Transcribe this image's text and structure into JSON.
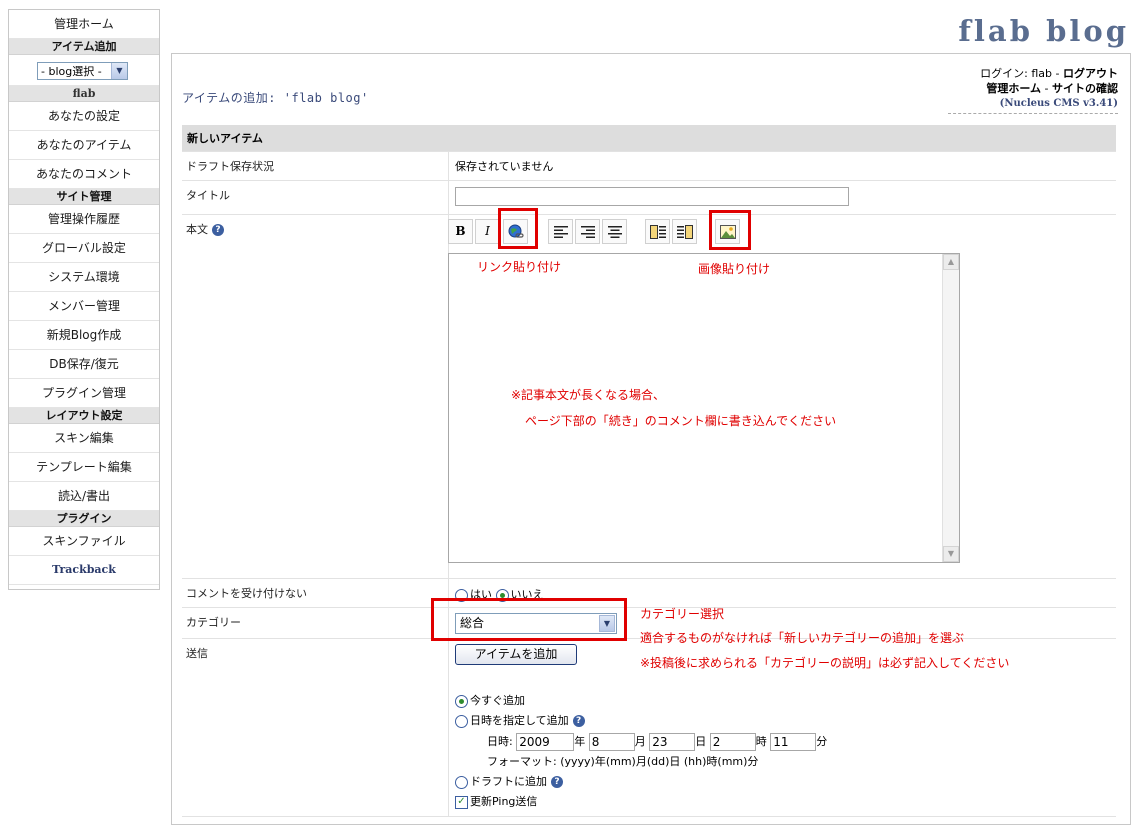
{
  "header": {
    "blog_title": "flab blog"
  },
  "sidebar": {
    "admin_home": "管理ホーム",
    "add_item_heading": "アイテム追加",
    "blog_select_value": "- blog選択 -",
    "user_heading": "flab",
    "your_settings": "あなたの設定",
    "your_items": "あなたのアイテム",
    "your_comments": "あなたのコメント",
    "site_admin_heading": "サイト管理",
    "action_log": "管理操作履歴",
    "global_settings": "グローバル設定",
    "system_env": "システム環境",
    "member_admin": "メンバー管理",
    "new_blog": "新規Blog作成",
    "db_backup": "DB保存/復元",
    "plugin_admin": "プラグイン管理",
    "layout_heading": "レイアウト設定",
    "skin_edit": "スキン編集",
    "template_edit": "テンプレート編集",
    "import_export": "読込/書出",
    "plugins_heading": "プラグイン",
    "skin_files": "スキンファイル",
    "trackback": "Trackback"
  },
  "login": {
    "prefix": "ログイン: flab - ",
    "logout": "ログアウト",
    "admin_home": "管理ホーム",
    "sep": " - ",
    "view_site": "サイトの確認",
    "cms_version": "(Nucleus CMS v3.41)"
  },
  "page": {
    "heading": "アイテムの追加: 'flab blog'"
  },
  "form": {
    "section_title": "新しいアイテム",
    "draft_status_label": "ドラフト保存状況",
    "draft_status_value": "保存されていません",
    "title_label": "タイトル",
    "title_value": "",
    "body_label": "本文",
    "toolbar": {
      "bold": "B",
      "italic": "I"
    },
    "no_comments_label": "コメントを受け付けない",
    "yes": "はい",
    "no": "いいえ",
    "category_label": "カテゴリー",
    "category_value": "総合",
    "submit_label": "送信",
    "submit_button": "アイテムを追加",
    "post_now": "今すぐ追加",
    "post_at_time": "日時を指定して追加",
    "datetime_label": "日時:",
    "year": "2009",
    "year_unit": "年",
    "month": "8",
    "month_unit": "月",
    "day": "23",
    "day_unit": "日",
    "hour": "2",
    "hour_unit": "時",
    "minute": "11",
    "minute_unit": "分",
    "format_hint": "フォーマット: (yyyy)年(mm)月(dd)日 (hh)時(mm)分",
    "add_to_draft": "ドラフトに追加",
    "send_ping": "更新Ping送信"
  },
  "annotations": {
    "link_paste": "リンク貼り付け",
    "image_paste": "画像貼り付け",
    "long_body_1": "※記事本文が長くなる場合、",
    "long_body_2": "ページ下部の「続き」のコメント欄に書き込んでください",
    "category_select": "カテゴリー選択",
    "category_hint": "適合するものがなければ「新しいカテゴリーの追加」を選ぶ",
    "category_note": "※投稿後に求められる「カテゴリーの説明」は必ず記入してください"
  },
  "colors": {
    "annotation_red": "#e00000",
    "heading_blue": "#5a6d8f"
  }
}
